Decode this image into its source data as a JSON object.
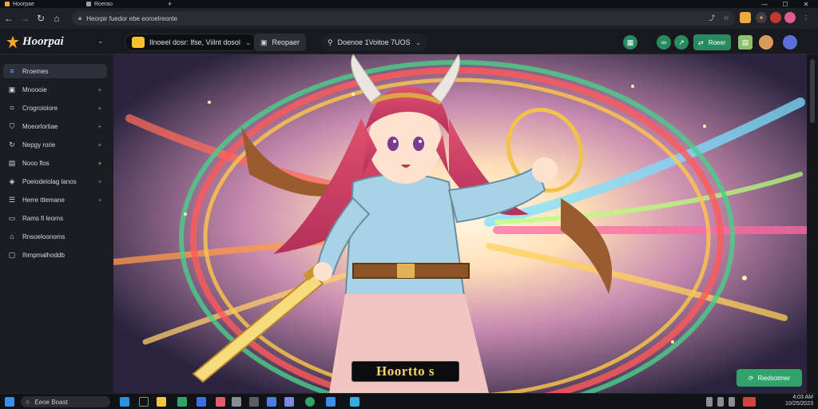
{
  "browser": {
    "tabs": [
      {
        "label": "Hoorpae"
      },
      {
        "label": "Roerao"
      }
    ],
    "new_tab": "+",
    "window_controls": [
      "—",
      "☐",
      "✕"
    ],
    "url": "Heorpir fuedor ebe eoroelreonte"
  },
  "app": {
    "logo_text": "Hoorpai",
    "header_pill_1": "Ilnoeel dosr: lfse, Viilnt dosol",
    "header_pill_2": "Reopaer",
    "header_pill_3": "Doenoe 1Voitoe 7UOS",
    "header_right_button": "Roeer"
  },
  "sidebar": {
    "items": [
      {
        "label": "Rroemes",
        "icon": "layers-icon",
        "action": "",
        "active": true
      },
      {
        "label": "Mnoooie",
        "icon": "image-icon",
        "action": "+"
      },
      {
        "label": "Crogroioiore",
        "icon": "crop-icon",
        "action": "+"
      },
      {
        "label": "Moeorlortiae",
        "icon": "shield-icon",
        "action": "+"
      },
      {
        "label": "Nepgy rorie",
        "icon": "refresh-icon",
        "action": "+"
      },
      {
        "label": "Nooo flos",
        "icon": "book-icon",
        "action": "+",
        "action_color": "#8bd35a"
      },
      {
        "label": "Poeiodeiolag lanos",
        "icon": "palette-icon",
        "action": "+",
        "action_color": "#e05c6b"
      },
      {
        "label": "Herre ttlemane",
        "icon": "list-icon",
        "action": "+",
        "action_color": "#e0505a"
      },
      {
        "label": "Rams fi leorns",
        "icon": "file-icon",
        "action": ""
      },
      {
        "label": "Rnsoeloonoms",
        "icon": "home-icon",
        "action": ""
      },
      {
        "label": "Ihmpmalhoddb",
        "icon": "save-icon",
        "action": ""
      }
    ]
  },
  "artwork": {
    "caption": "Hoortto s"
  },
  "fab": {
    "label": "Riedsotmer"
  },
  "taskbar": {
    "search_placeholder": "Eeoe Boast",
    "clock_time": "4:03 AM",
    "clock_date": "10/25/2023"
  },
  "colors": {
    "accent_yellow": "#f5c12e",
    "accent_green": "#2fa36b",
    "brand_orange": "#f5a623"
  }
}
